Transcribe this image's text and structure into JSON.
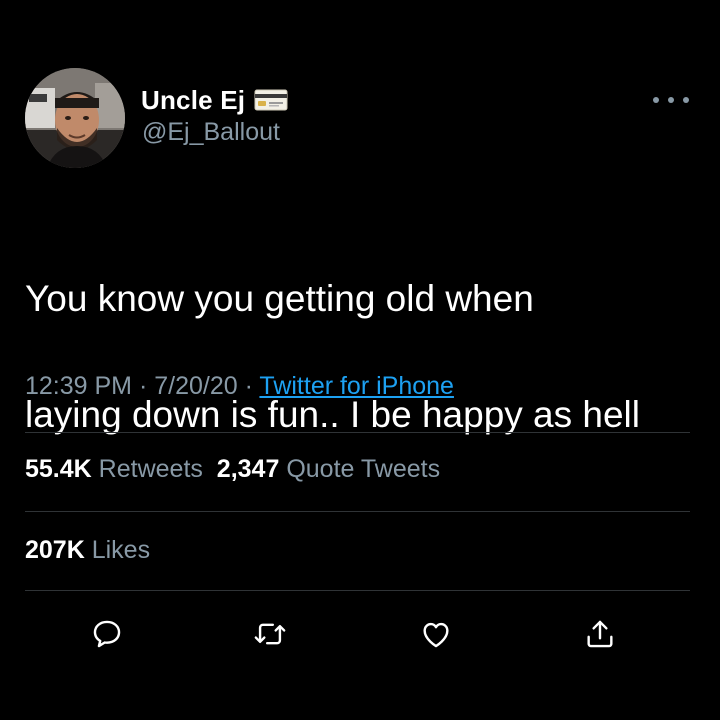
{
  "user": {
    "display_name": "Uncle Ej",
    "handle": "@Ej_Ballout",
    "name_emoji_icon": "credit-card-icon"
  },
  "tweet": {
    "text_line_1": "You know you getting old when",
    "text_line_2": "laying down is fun.. I be happy as hell"
  },
  "meta": {
    "time": "12:39 PM",
    "separator": " · ",
    "date": "7/20/20",
    "source": "Twitter for iPhone"
  },
  "stats": {
    "retweets_count": "55.4K",
    "retweets_label": "Retweets",
    "quotes_count": "2,347",
    "quotes_label": "Quote Tweets",
    "likes_count": "207K",
    "likes_label": "Likes"
  },
  "actions": {
    "reply_icon": "reply-icon",
    "retweet_icon": "retweet-icon",
    "like_icon": "heart-icon",
    "share_icon": "share-icon"
  },
  "colors": {
    "background": "#000000",
    "text_primary": "#ffffff",
    "text_secondary": "#8899a6",
    "link": "#1da1f2",
    "divider": "#2f3336"
  }
}
